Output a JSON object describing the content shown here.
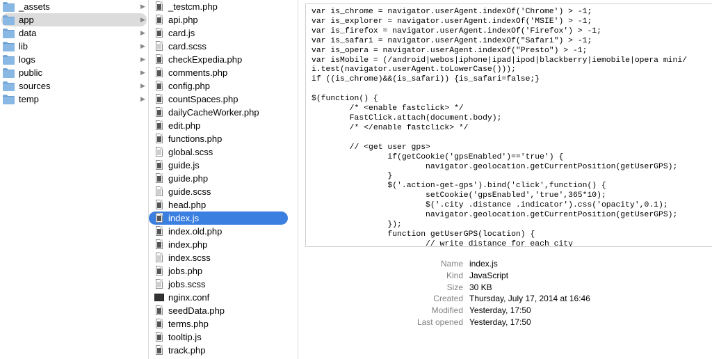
{
  "folders": [
    {
      "name": "_assets",
      "selected": false
    },
    {
      "name": "app",
      "selected": true
    },
    {
      "name": "data",
      "selected": false
    },
    {
      "name": "lib",
      "selected": false
    },
    {
      "name": "logs",
      "selected": false
    },
    {
      "name": "public",
      "selected": false
    },
    {
      "name": "sources",
      "selected": false
    },
    {
      "name": "temp",
      "selected": false
    }
  ],
  "files": [
    {
      "name": "_testcm.php",
      "icon": "php-file-icon",
      "selected": false
    },
    {
      "name": "api.php",
      "icon": "php-file-icon",
      "selected": false
    },
    {
      "name": "card.js",
      "icon": "js-file-icon",
      "selected": false
    },
    {
      "name": "card.scss",
      "icon": "scss-file-icon",
      "selected": false
    },
    {
      "name": "checkExpedia.php",
      "icon": "php-file-icon",
      "selected": false
    },
    {
      "name": "comments.php",
      "icon": "php-file-icon",
      "selected": false
    },
    {
      "name": "config.php",
      "icon": "php-file-icon",
      "selected": false
    },
    {
      "name": "countSpaces.php",
      "icon": "php-file-icon",
      "selected": false
    },
    {
      "name": "dailyCacheWorker.php",
      "icon": "php-file-icon",
      "selected": false
    },
    {
      "name": "edit.php",
      "icon": "php-file-icon",
      "selected": false
    },
    {
      "name": "functions.php",
      "icon": "php-file-icon",
      "selected": false
    },
    {
      "name": "global.scss",
      "icon": "scss-file-icon",
      "selected": false
    },
    {
      "name": "guide.js",
      "icon": "js-file-icon",
      "selected": false
    },
    {
      "name": "guide.php",
      "icon": "php-file-icon",
      "selected": false
    },
    {
      "name": "guide.scss",
      "icon": "scss-file-icon",
      "selected": false
    },
    {
      "name": "head.php",
      "icon": "php-file-icon",
      "selected": false
    },
    {
      "name": "index.js",
      "icon": "js-file-icon",
      "selected": true
    },
    {
      "name": "index.old.php",
      "icon": "php-file-icon",
      "selected": false
    },
    {
      "name": "index.php",
      "icon": "php-file-icon",
      "selected": false
    },
    {
      "name": "index.scss",
      "icon": "scss-file-icon",
      "selected": false
    },
    {
      "name": "jobs.php",
      "icon": "php-file-icon",
      "selected": false
    },
    {
      "name": "jobs.scss",
      "icon": "scss-file-icon",
      "selected": false
    },
    {
      "name": "nginx.conf",
      "icon": "conf-file-icon",
      "selected": false
    },
    {
      "name": "seedData.php",
      "icon": "php-file-icon",
      "selected": false
    },
    {
      "name": "terms.php",
      "icon": "php-file-icon",
      "selected": false
    },
    {
      "name": "tooltip.js",
      "icon": "js-file-icon",
      "selected": false
    },
    {
      "name": "track.php",
      "icon": "php-file-icon",
      "selected": false
    }
  ],
  "preview": {
    "code": "var is_chrome = navigator.userAgent.indexOf('Chrome') > -1;\nvar is_explorer = navigator.userAgent.indexOf('MSIE') > -1;\nvar is_firefox = navigator.userAgent.indexOf('Firefox') > -1;\nvar is_safari = navigator.userAgent.indexOf(\"Safari\") > -1;\nvar is_opera = navigator.userAgent.indexOf(\"Presto\") > -1;\nvar isMobile = (/android|webos|iphone|ipad|ipod|blackberry|iemobile|opera mini/\ni.test(navigator.userAgent.toLowerCase()));\nif ((is_chrome)&&(is_safari)) {is_safari=false;}\n\n$(function() {\n        /* <enable fastclick> */\n        FastClick.attach(document.body);\n        /* </enable fastclick> */\n\n        // <get user gps>\n                if(getCookie('gpsEnabled')=='true') {\n                        navigator.geolocation.getCurrentPosition(getUserGPS);\n                }\n                $('.action-get-gps').bind('click',function() {\n                        setCookie('gpsEnabled','true',365*10);\n                        $('.city .distance .indicator').css('opacity',0.1);\n                        navigator.geolocation.getCurrentPosition(getUserGPS);\n                });\n                function getUserGPS(location) {\n                        // write distance for each city\n                        $('.city').each(function() {"
  },
  "info": [
    {
      "key": "Name",
      "value": "index.js"
    },
    {
      "key": "Kind",
      "value": "JavaScript"
    },
    {
      "key": "Size",
      "value": "30 KB"
    },
    {
      "key": "Created",
      "value": "Thursday, July 17, 2014 at 16:46"
    },
    {
      "key": "Modified",
      "value": "Yesterday, 17:50"
    },
    {
      "key": "Last opened",
      "value": "Yesterday, 17:50"
    }
  ],
  "colors": {
    "selection_active": "#3b7fe0",
    "selection_inactive": "#dcdcdc",
    "folder": "#8ab8e4"
  },
  "arrow_glyph": "▶"
}
